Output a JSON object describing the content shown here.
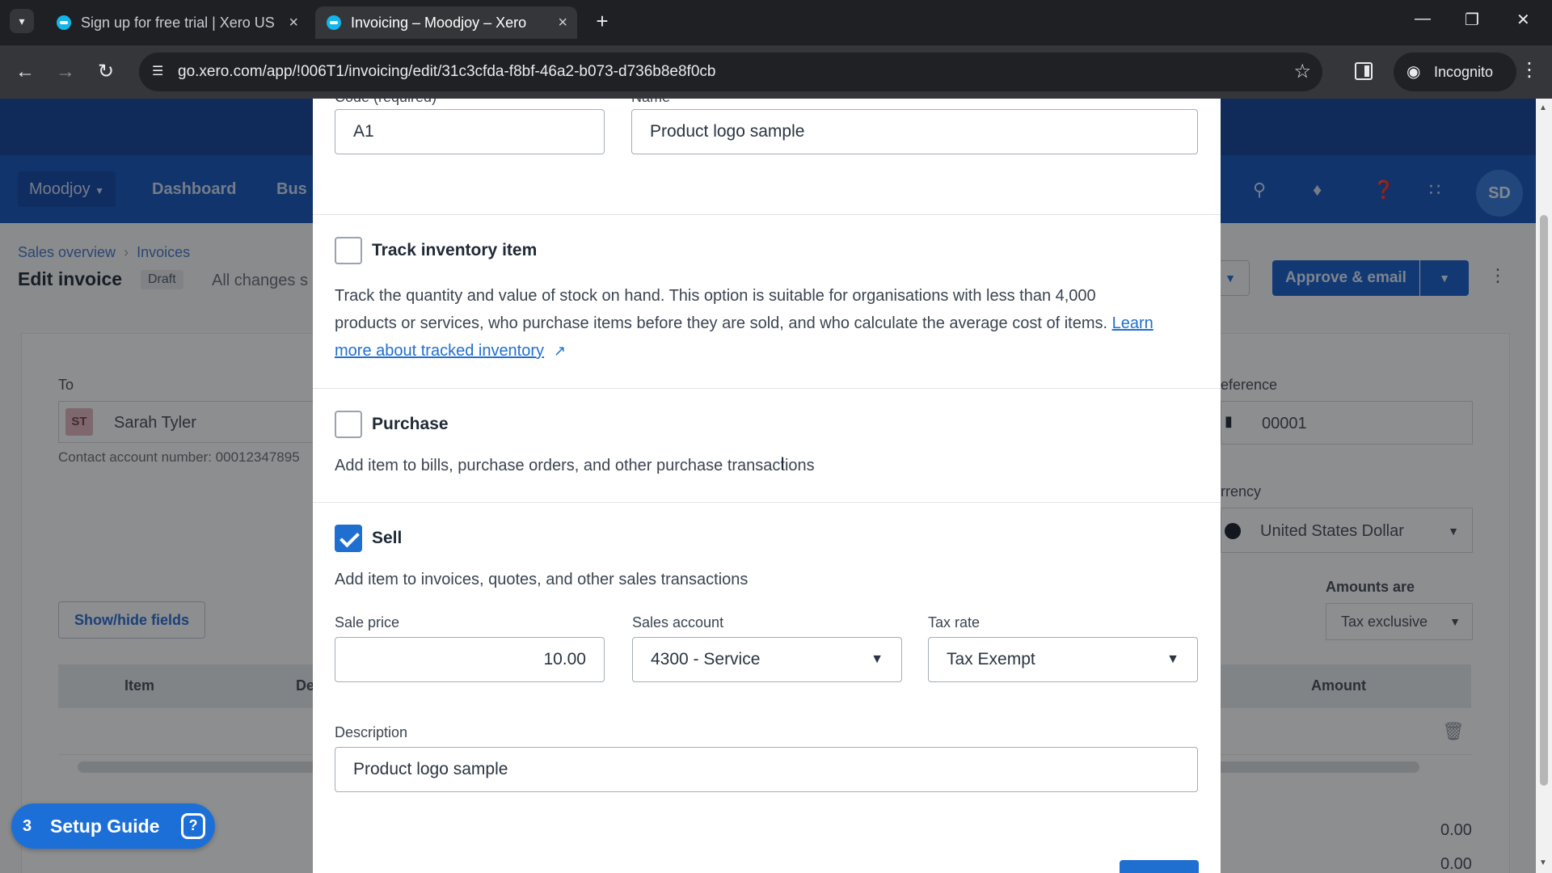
{
  "browser": {
    "tabs": [
      {
        "title": "Sign up for free trial | Xero US"
      },
      {
        "title": "Invoicing – Moodjoy – Xero"
      }
    ],
    "url": "go.xero.com/app/!006T1/invoicing/edit/31c3cfda-f8bf-46a2-b073-d736b8e8f0cb",
    "incognito_label": "Incognito"
  },
  "app": {
    "org_name": "Moodjoy",
    "nav": [
      "Dashboard",
      "Bus"
    ],
    "avatar_initials": "SD",
    "breadcrumb": [
      "Sales overview",
      "Invoices"
    ],
    "page_title": "Edit invoice",
    "status_badge": "Draft",
    "save_status": "All changes s",
    "approve_label": "Approve & email",
    "to_label": "To",
    "contact_initials": "ST",
    "contact_name": "Sarah Tyler",
    "contact_account": "Contact account number: 00012347895",
    "reference_label": "eference",
    "reference_value": "00001",
    "currency_label": "rrency",
    "currency_value": "United States Dollar",
    "amounts_label": "Amounts are",
    "amounts_value": "Tax exclusive",
    "show_hide_label": "Show/hide fields",
    "table_headers": {
      "item": "Item",
      "description": "De",
      "amount": "Amount"
    },
    "totals": [
      "0.00",
      "0.00"
    ],
    "setup_guide": {
      "count": "3",
      "label": "Setup Guide"
    }
  },
  "modal": {
    "code_label": "Code (required)",
    "name_label": "Name",
    "code_value": "A1",
    "name_value": "Product logo sample",
    "track_inventory": {
      "label": "Track inventory item",
      "checked": false,
      "line1": "Track the quantity and value of stock on hand. This option is suitable for organisations with less than 4,000",
      "line2": "products or services, who purchase items before they are sold, and who calculate the average cost of items.",
      "link_part1": "Learn",
      "link_part2": "more about tracked inventory"
    },
    "purchase": {
      "label": "Purchase",
      "checked": false,
      "description": "Add item to bills, purchase orders, and other purchase transactions"
    },
    "sell": {
      "label": "Sell",
      "checked": true,
      "description": "Add item to invoices, quotes, and other sales transactions",
      "sale_price_label": "Sale price",
      "sale_price": "10.00",
      "sales_account_label": "Sales account",
      "sales_account": "4300 - Service",
      "tax_rate_label": "Tax rate",
      "tax_rate": "Tax Exempt",
      "description_label": "Description",
      "description_value": "Product logo sample"
    }
  }
}
